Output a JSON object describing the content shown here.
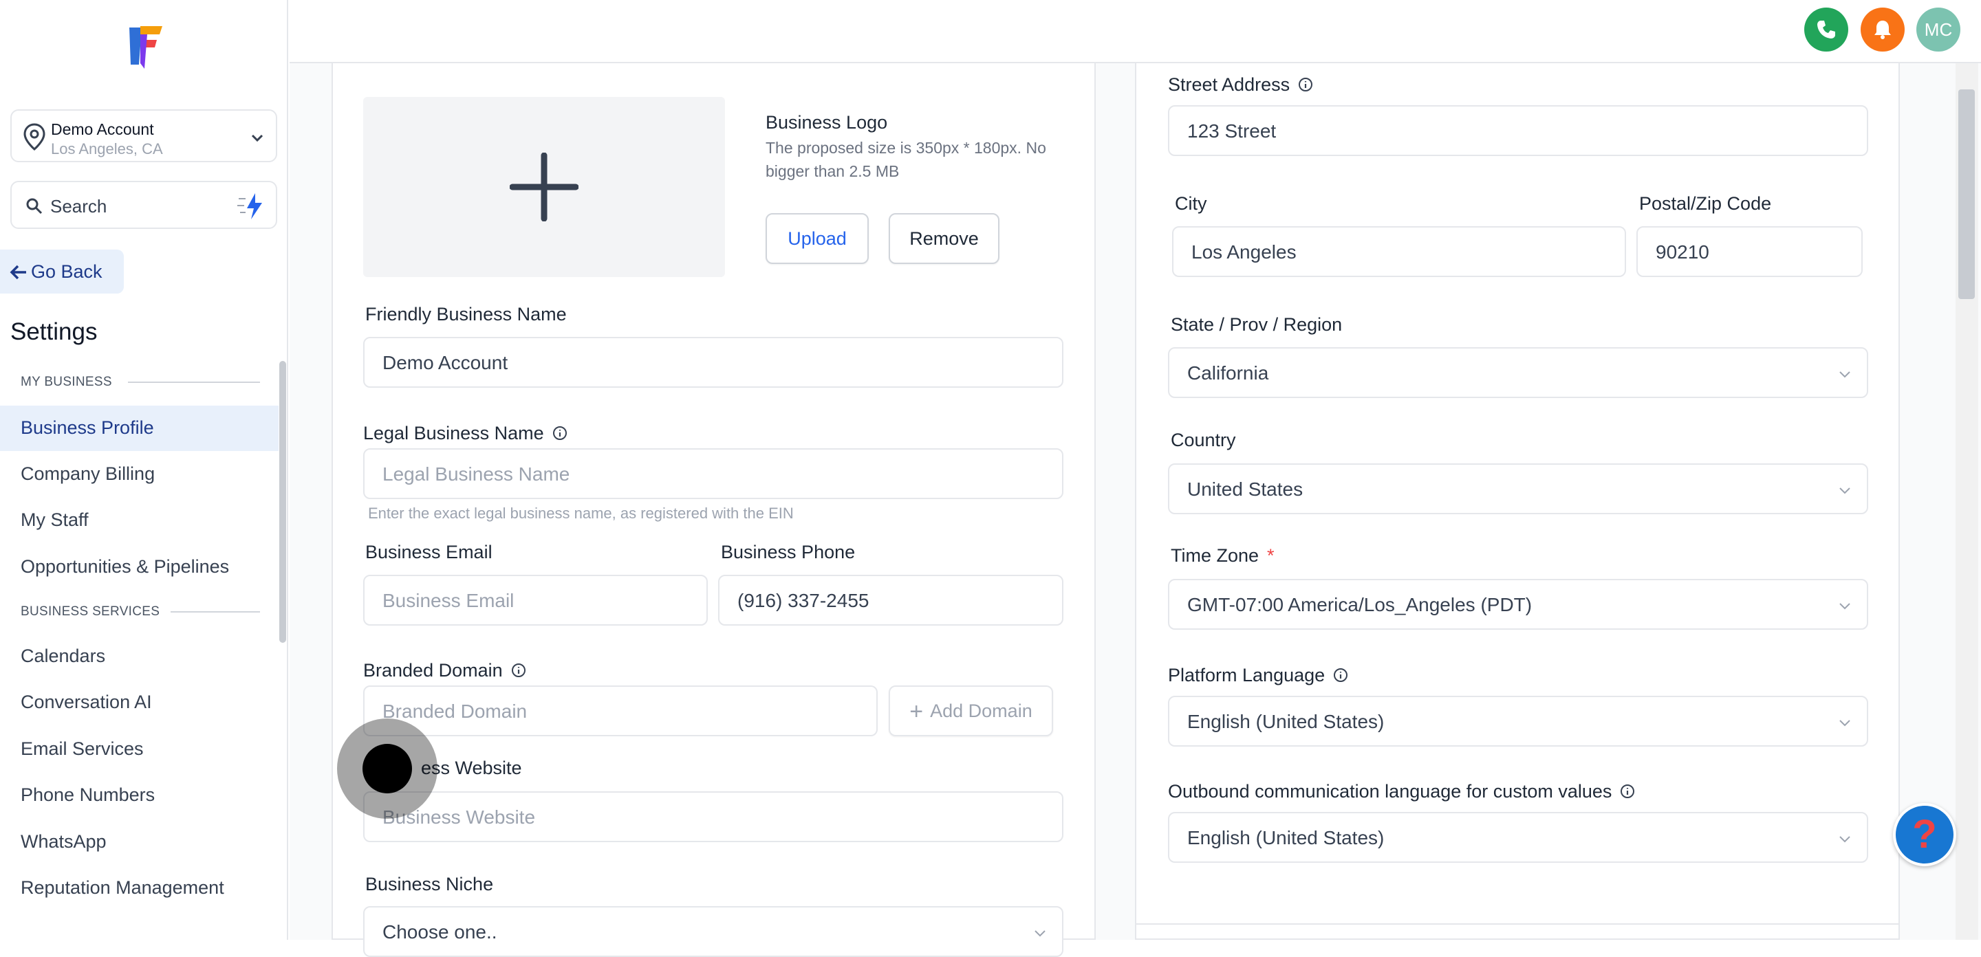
{
  "sidebar": {
    "account": {
      "name": "Demo Account",
      "location": "Los Angeles, CA"
    },
    "search": {
      "placeholder": "Search"
    },
    "go_back": "Go Back",
    "title": "Settings",
    "sections": [
      {
        "header": "MY BUSINESS",
        "items": [
          "Business Profile",
          "Company Billing",
          "My Staff",
          "Opportunities & Pipelines"
        ]
      },
      {
        "header": "BUSINESS SERVICES",
        "items": [
          "Calendars",
          "Conversation AI",
          "Email Services",
          "Phone Numbers",
          "WhatsApp",
          "Reputation Management"
        ]
      }
    ],
    "active_item": "Business Profile"
  },
  "topbar": {
    "avatar_initials": "MC"
  },
  "left_form": {
    "logo": {
      "title": "Business Logo",
      "description": "The proposed size is 350px * 180px. No bigger than 2.5 MB",
      "upload_label": "Upload",
      "remove_label": "Remove"
    },
    "friendly_name": {
      "label": "Friendly Business Name",
      "value": "Demo Account"
    },
    "legal_name": {
      "label": "Legal Business Name",
      "placeholder": "Legal Business Name",
      "hint": "Enter the exact legal business name, as registered with the EIN"
    },
    "email": {
      "label": "Business Email",
      "placeholder": "Business Email"
    },
    "phone": {
      "label": "Business Phone",
      "value": "(916) 337-2455"
    },
    "branded_domain": {
      "label": "Branded Domain",
      "placeholder": "Branded Domain",
      "add_label": "Add Domain"
    },
    "website": {
      "label": "ess Website",
      "placeholder": "Business Website"
    },
    "niche": {
      "label": "Business Niche",
      "value": "Choose one.."
    }
  },
  "right_form": {
    "street": {
      "label": "Street Address",
      "value": "123 Street"
    },
    "city": {
      "label": "City",
      "value": "Los Angeles"
    },
    "zip": {
      "label": "Postal/Zip Code",
      "value": "90210"
    },
    "state": {
      "label": "State / Prov / Region",
      "value": "California"
    },
    "country": {
      "label": "Country",
      "value": "United States"
    },
    "timezone": {
      "label": "Time Zone",
      "required": "*",
      "value": "GMT-07:00 America/Los_Angeles (PDT)"
    },
    "platform_language": {
      "label": "Platform Language",
      "value": "English (United States)"
    },
    "outbound_language": {
      "label": "Outbound communication language for custom values",
      "value": "English (United States)"
    }
  },
  "help_button": "?",
  "colors": {
    "accent": "#2563eb",
    "active_nav_bg": "#e8f0fb",
    "phone": "#22a55a",
    "bell": "#f97316",
    "avatar": "#7cc3b0"
  },
  "icons": [
    "app-logo-icon",
    "location-pin-icon",
    "chevron-down-icon",
    "search-icon",
    "lightning-icon",
    "arrow-left-icon",
    "phone-icon",
    "bell-icon",
    "plus-icon",
    "info-icon",
    "help-icon"
  ]
}
